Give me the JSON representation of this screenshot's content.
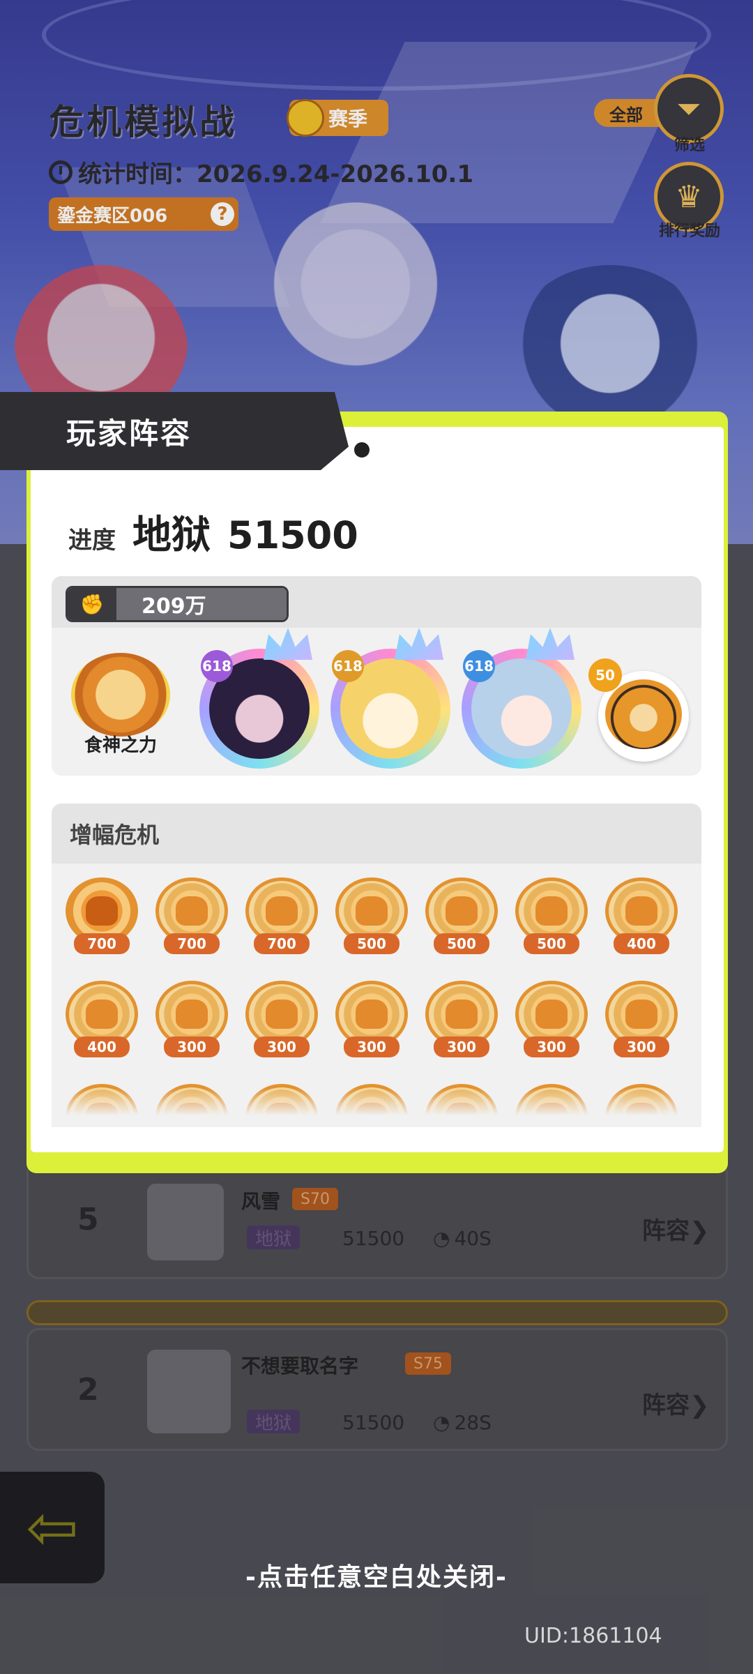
{
  "header": {
    "title": "危机模拟战",
    "season_label": "赛季",
    "stat_time": "统计时间：2026.9.24-2026.10.1",
    "region": "鎏金赛区006",
    "region_help": "?",
    "filter_all": "全部",
    "filter_label": "筛选",
    "rank_reward_label": "排行奖励"
  },
  "modal": {
    "title": "玩家阵容",
    "progress_label": "进度",
    "difficulty": "地狱",
    "score": "51500",
    "team": {
      "power": "209万",
      "food_god_label": "食神之力",
      "heroes": [
        {
          "level": "618"
        },
        {
          "level": "618"
        },
        {
          "level": "618"
        }
      ],
      "pet_level": "50"
    },
    "amplify": {
      "title": "增幅危机",
      "medals": [
        "700",
        "700",
        "700",
        "500",
        "500",
        "500",
        "400",
        "400",
        "300",
        "300",
        "300",
        "300",
        "300",
        "300"
      ]
    }
  },
  "rows": [
    {
      "rank": "5",
      "name": "风雪",
      "level": "S70",
      "difficulty": "地狱",
      "score": "51500",
      "time": "40S",
      "lineup": "阵容"
    },
    {
      "rank": "2",
      "name": "不想要取名字",
      "level": "S75",
      "difficulty": "地狱",
      "score": "51500",
      "time": "28S",
      "lineup": "阵容"
    }
  ],
  "close_hint": "-点击任意空白处关闭-",
  "uid": "UID:1861104",
  "colors": {
    "accent_lime": "#dcf03a",
    "orange": "#e0922e",
    "dark": "#2f2f33"
  }
}
